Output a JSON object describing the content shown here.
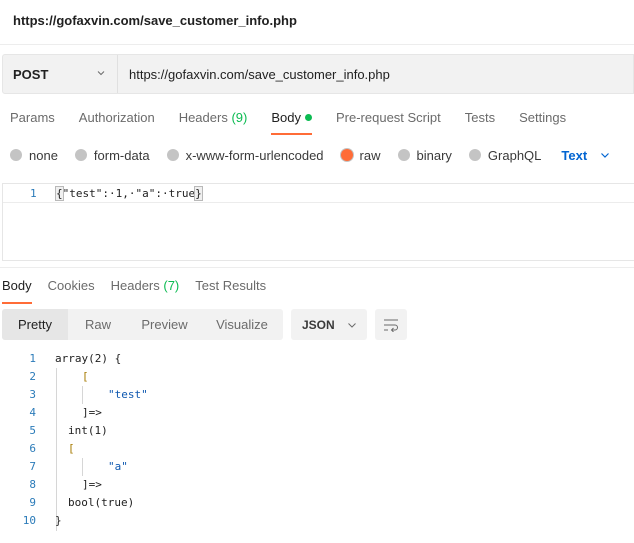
{
  "window": {
    "title": "https://gofaxvin.com/save_customer_info.php"
  },
  "request": {
    "method": "POST",
    "url": "https://gofaxvin.com/save_customer_info.php",
    "tabs": [
      {
        "label": "Params"
      },
      {
        "label": "Authorization"
      },
      {
        "label": "Headers",
        "count": "(9)"
      },
      {
        "label": "Body",
        "active": true,
        "indicator": "green-dot"
      },
      {
        "label": "Pre-request Script"
      },
      {
        "label": "Tests"
      },
      {
        "label": "Settings"
      }
    ],
    "body_types": [
      {
        "label": "none",
        "selected": false
      },
      {
        "label": "form-data",
        "selected": false
      },
      {
        "label": "x-www-form-urlencoded",
        "selected": false
      },
      {
        "label": "raw",
        "selected": true
      },
      {
        "label": "binary",
        "selected": false
      },
      {
        "label": "GraphQL",
        "selected": false
      }
    ],
    "raw_format": "Text",
    "body_editor": {
      "lines": [
        {
          "num": "1",
          "text": "{\"test\":·1,·\"a\":·true}"
        }
      ],
      "open_brace": "{",
      "content": "\"test\":·1,·\"a\":·true",
      "close_brace": "}"
    }
  },
  "response": {
    "tabs": [
      {
        "label": "Body",
        "active": true
      },
      {
        "label": "Cookies"
      },
      {
        "label": "Headers",
        "count": "(7)"
      },
      {
        "label": "Test Results"
      }
    ],
    "view_modes": [
      "Pretty",
      "Raw",
      "Preview",
      "Visualize"
    ],
    "active_view": "Pretty",
    "format": "JSON",
    "lines": [
      {
        "num": "1",
        "text": "array(2) {"
      },
      {
        "num": "2",
        "text": "["
      },
      {
        "num": "3",
        "text": "\"test\""
      },
      {
        "num": "4",
        "text": "]=>"
      },
      {
        "num": "5",
        "text": "int(1)"
      },
      {
        "num": "6",
        "text": "["
      },
      {
        "num": "7",
        "text": "\"a\""
      },
      {
        "num": "8",
        "text": "]=>"
      },
      {
        "num": "9",
        "text": "bool(true)"
      },
      {
        "num": "10",
        "text": "}"
      }
    ]
  },
  "colors": {
    "accent_orange": "#ff6c37",
    "success_green": "#0cbb52",
    "link_blue": "#0265d2"
  }
}
